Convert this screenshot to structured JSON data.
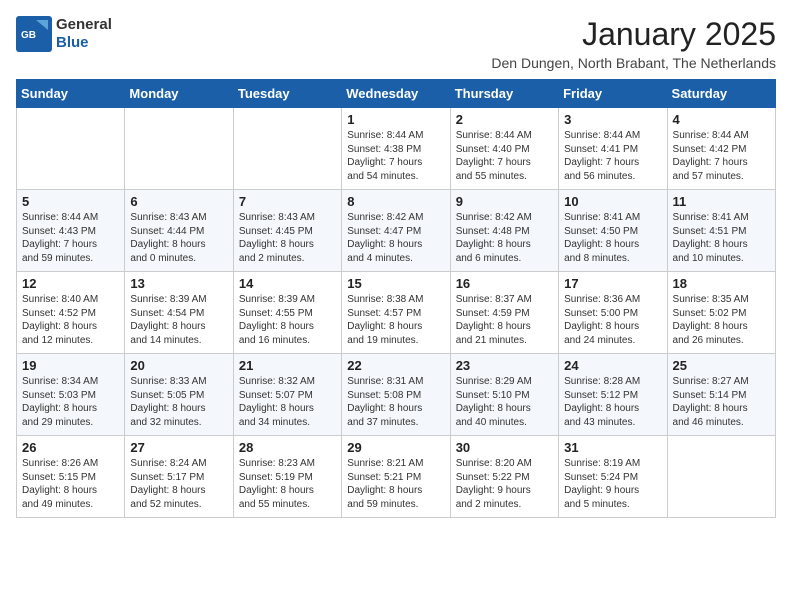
{
  "logo": {
    "text_general": "General",
    "text_blue": "Blue"
  },
  "header": {
    "month_title": "January 2025",
    "location": "Den Dungen, North Brabant, The Netherlands"
  },
  "weekdays": [
    "Sunday",
    "Monday",
    "Tuesday",
    "Wednesday",
    "Thursday",
    "Friday",
    "Saturday"
  ],
  "weeks": [
    [
      {
        "day": "",
        "lines": []
      },
      {
        "day": "",
        "lines": []
      },
      {
        "day": "",
        "lines": []
      },
      {
        "day": "1",
        "lines": [
          "Sunrise: 8:44 AM",
          "Sunset: 4:38 PM",
          "Daylight: 7 hours",
          "and 54 minutes."
        ]
      },
      {
        "day": "2",
        "lines": [
          "Sunrise: 8:44 AM",
          "Sunset: 4:40 PM",
          "Daylight: 7 hours",
          "and 55 minutes."
        ]
      },
      {
        "day": "3",
        "lines": [
          "Sunrise: 8:44 AM",
          "Sunset: 4:41 PM",
          "Daylight: 7 hours",
          "and 56 minutes."
        ]
      },
      {
        "day": "4",
        "lines": [
          "Sunrise: 8:44 AM",
          "Sunset: 4:42 PM",
          "Daylight: 7 hours",
          "and 57 minutes."
        ]
      }
    ],
    [
      {
        "day": "5",
        "lines": [
          "Sunrise: 8:44 AM",
          "Sunset: 4:43 PM",
          "Daylight: 7 hours",
          "and 59 minutes."
        ]
      },
      {
        "day": "6",
        "lines": [
          "Sunrise: 8:43 AM",
          "Sunset: 4:44 PM",
          "Daylight: 8 hours",
          "and 0 minutes."
        ]
      },
      {
        "day": "7",
        "lines": [
          "Sunrise: 8:43 AM",
          "Sunset: 4:45 PM",
          "Daylight: 8 hours",
          "and 2 minutes."
        ]
      },
      {
        "day": "8",
        "lines": [
          "Sunrise: 8:42 AM",
          "Sunset: 4:47 PM",
          "Daylight: 8 hours",
          "and 4 minutes."
        ]
      },
      {
        "day": "9",
        "lines": [
          "Sunrise: 8:42 AM",
          "Sunset: 4:48 PM",
          "Daylight: 8 hours",
          "and 6 minutes."
        ]
      },
      {
        "day": "10",
        "lines": [
          "Sunrise: 8:41 AM",
          "Sunset: 4:50 PM",
          "Daylight: 8 hours",
          "and 8 minutes."
        ]
      },
      {
        "day": "11",
        "lines": [
          "Sunrise: 8:41 AM",
          "Sunset: 4:51 PM",
          "Daylight: 8 hours",
          "and 10 minutes."
        ]
      }
    ],
    [
      {
        "day": "12",
        "lines": [
          "Sunrise: 8:40 AM",
          "Sunset: 4:52 PM",
          "Daylight: 8 hours",
          "and 12 minutes."
        ]
      },
      {
        "day": "13",
        "lines": [
          "Sunrise: 8:39 AM",
          "Sunset: 4:54 PM",
          "Daylight: 8 hours",
          "and 14 minutes."
        ]
      },
      {
        "day": "14",
        "lines": [
          "Sunrise: 8:39 AM",
          "Sunset: 4:55 PM",
          "Daylight: 8 hours",
          "and 16 minutes."
        ]
      },
      {
        "day": "15",
        "lines": [
          "Sunrise: 8:38 AM",
          "Sunset: 4:57 PM",
          "Daylight: 8 hours",
          "and 19 minutes."
        ]
      },
      {
        "day": "16",
        "lines": [
          "Sunrise: 8:37 AM",
          "Sunset: 4:59 PM",
          "Daylight: 8 hours",
          "and 21 minutes."
        ]
      },
      {
        "day": "17",
        "lines": [
          "Sunrise: 8:36 AM",
          "Sunset: 5:00 PM",
          "Daylight: 8 hours",
          "and 24 minutes."
        ]
      },
      {
        "day": "18",
        "lines": [
          "Sunrise: 8:35 AM",
          "Sunset: 5:02 PM",
          "Daylight: 8 hours",
          "and 26 minutes."
        ]
      }
    ],
    [
      {
        "day": "19",
        "lines": [
          "Sunrise: 8:34 AM",
          "Sunset: 5:03 PM",
          "Daylight: 8 hours",
          "and 29 minutes."
        ]
      },
      {
        "day": "20",
        "lines": [
          "Sunrise: 8:33 AM",
          "Sunset: 5:05 PM",
          "Daylight: 8 hours",
          "and 32 minutes."
        ]
      },
      {
        "day": "21",
        "lines": [
          "Sunrise: 8:32 AM",
          "Sunset: 5:07 PM",
          "Daylight: 8 hours",
          "and 34 minutes."
        ]
      },
      {
        "day": "22",
        "lines": [
          "Sunrise: 8:31 AM",
          "Sunset: 5:08 PM",
          "Daylight: 8 hours",
          "and 37 minutes."
        ]
      },
      {
        "day": "23",
        "lines": [
          "Sunrise: 8:29 AM",
          "Sunset: 5:10 PM",
          "Daylight: 8 hours",
          "and 40 minutes."
        ]
      },
      {
        "day": "24",
        "lines": [
          "Sunrise: 8:28 AM",
          "Sunset: 5:12 PM",
          "Daylight: 8 hours",
          "and 43 minutes."
        ]
      },
      {
        "day": "25",
        "lines": [
          "Sunrise: 8:27 AM",
          "Sunset: 5:14 PM",
          "Daylight: 8 hours",
          "and 46 minutes."
        ]
      }
    ],
    [
      {
        "day": "26",
        "lines": [
          "Sunrise: 8:26 AM",
          "Sunset: 5:15 PM",
          "Daylight: 8 hours",
          "and 49 minutes."
        ]
      },
      {
        "day": "27",
        "lines": [
          "Sunrise: 8:24 AM",
          "Sunset: 5:17 PM",
          "Daylight: 8 hours",
          "and 52 minutes."
        ]
      },
      {
        "day": "28",
        "lines": [
          "Sunrise: 8:23 AM",
          "Sunset: 5:19 PM",
          "Daylight: 8 hours",
          "and 55 minutes."
        ]
      },
      {
        "day": "29",
        "lines": [
          "Sunrise: 8:21 AM",
          "Sunset: 5:21 PM",
          "Daylight: 8 hours",
          "and 59 minutes."
        ]
      },
      {
        "day": "30",
        "lines": [
          "Sunrise: 8:20 AM",
          "Sunset: 5:22 PM",
          "Daylight: 9 hours",
          "and 2 minutes."
        ]
      },
      {
        "day": "31",
        "lines": [
          "Sunrise: 8:19 AM",
          "Sunset: 5:24 PM",
          "Daylight: 9 hours",
          "and 5 minutes."
        ]
      },
      {
        "day": "",
        "lines": []
      }
    ]
  ]
}
